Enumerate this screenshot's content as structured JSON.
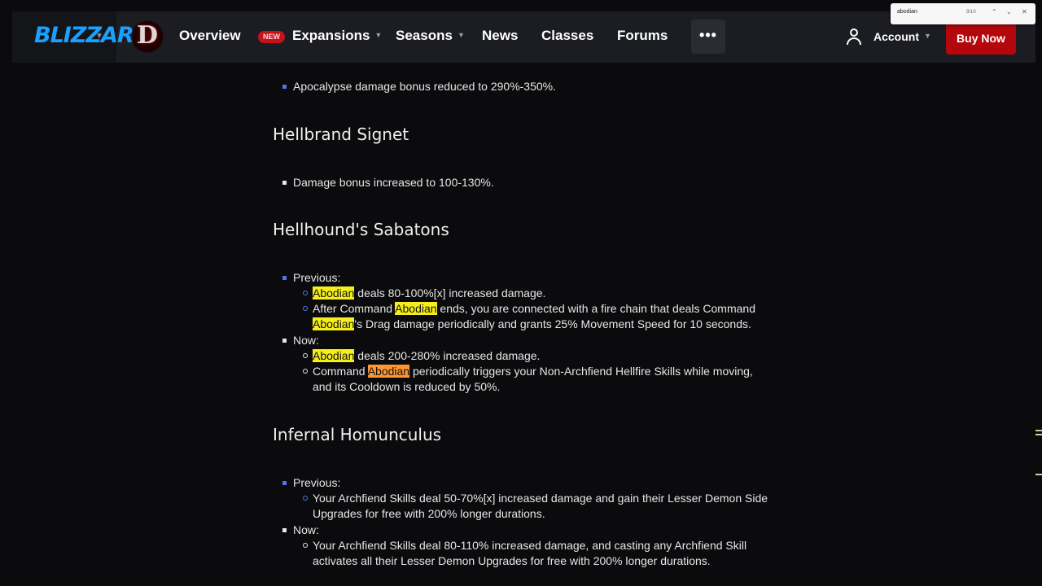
{
  "nav": {
    "brand": "BLIZZARD",
    "game_logo": "D",
    "items": {
      "overview": "Overview",
      "new_badge": "NEW",
      "expansions": "Expansions",
      "seasons": "Seasons",
      "news": "News",
      "classes": "Classes",
      "forums": "Forums"
    },
    "more": "•••",
    "account": "Account",
    "buy": "Buy Now"
  },
  "findbar": {
    "query": "abodian",
    "count": "9/10"
  },
  "sections": {
    "top_line": "Apocalypse damage bonus reduced to 290%-350%.",
    "hellbrand": {
      "title": "Hellbrand Signet",
      "line1": "Damage bonus increased to 100-130%."
    },
    "hellhound": {
      "title": "Hellhound's Sabatons",
      "previous_label": "Previous:",
      "now_label": "Now:",
      "keyword": "Abodian",
      "p1_rest": " deals 80-100%[x] increased damage.",
      "p2_a": "After Command ",
      "p2_b": " ends, you are connected with a fire chain that deals Command",
      "p2_c": "'s Drag damage periodically and grants 25% Movement Speed for 10 seconds.",
      "n1_rest": " deals 200-280% increased damage.",
      "n2_a": "Command ",
      "n2_b": " periodically triggers your Non-Archfiend Hellfire Skills while moving,",
      "n2_c": "and its Cooldown is reduced by 50%."
    },
    "homunculus": {
      "title": "Infernal Homunculus",
      "previous_label": "Previous:",
      "now_label": "Now:",
      "p1_a": "Your Archfiend Skills deal 50-70%[x] increased damage and gain their Lesser Demon Side",
      "p1_b": "Upgrades for free with 200% longer durations.",
      "n1_a": "Your Archfiend Skills deal 80-110% increased damage, and casting any Archfiend Skill",
      "n1_b": "activates all their Lesser Demon Upgrades for free with 200% longer durations."
    }
  }
}
